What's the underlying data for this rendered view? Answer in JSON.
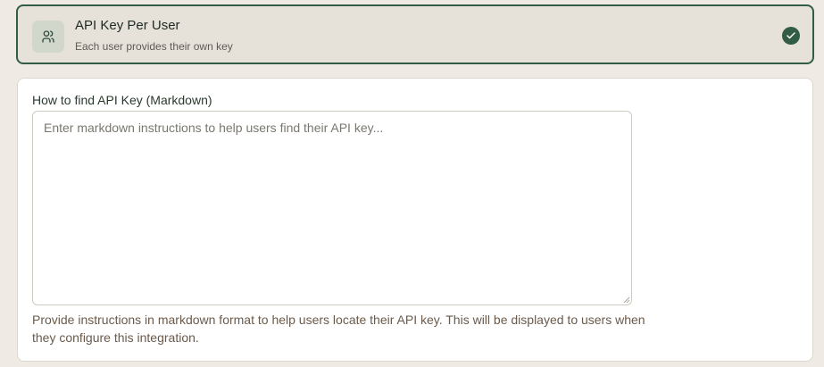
{
  "option": {
    "title": "API Key Per User",
    "subtitle": "Each user provides their own key",
    "icon": "users-icon",
    "selected": true,
    "selected_icon": "check-icon"
  },
  "form": {
    "label": "How to find API Key (Markdown)",
    "value": "",
    "placeholder": "Enter markdown instructions to help users find their API key...",
    "help": "Provide instructions in markdown format to help users locate their API key. This will be displayed to users when they configure this integration."
  },
  "colors": {
    "accent": "#335c44",
    "background": "#efebe4",
    "card_selected_bg": "#e6e2da",
    "help_text": "#6b5a4a"
  }
}
